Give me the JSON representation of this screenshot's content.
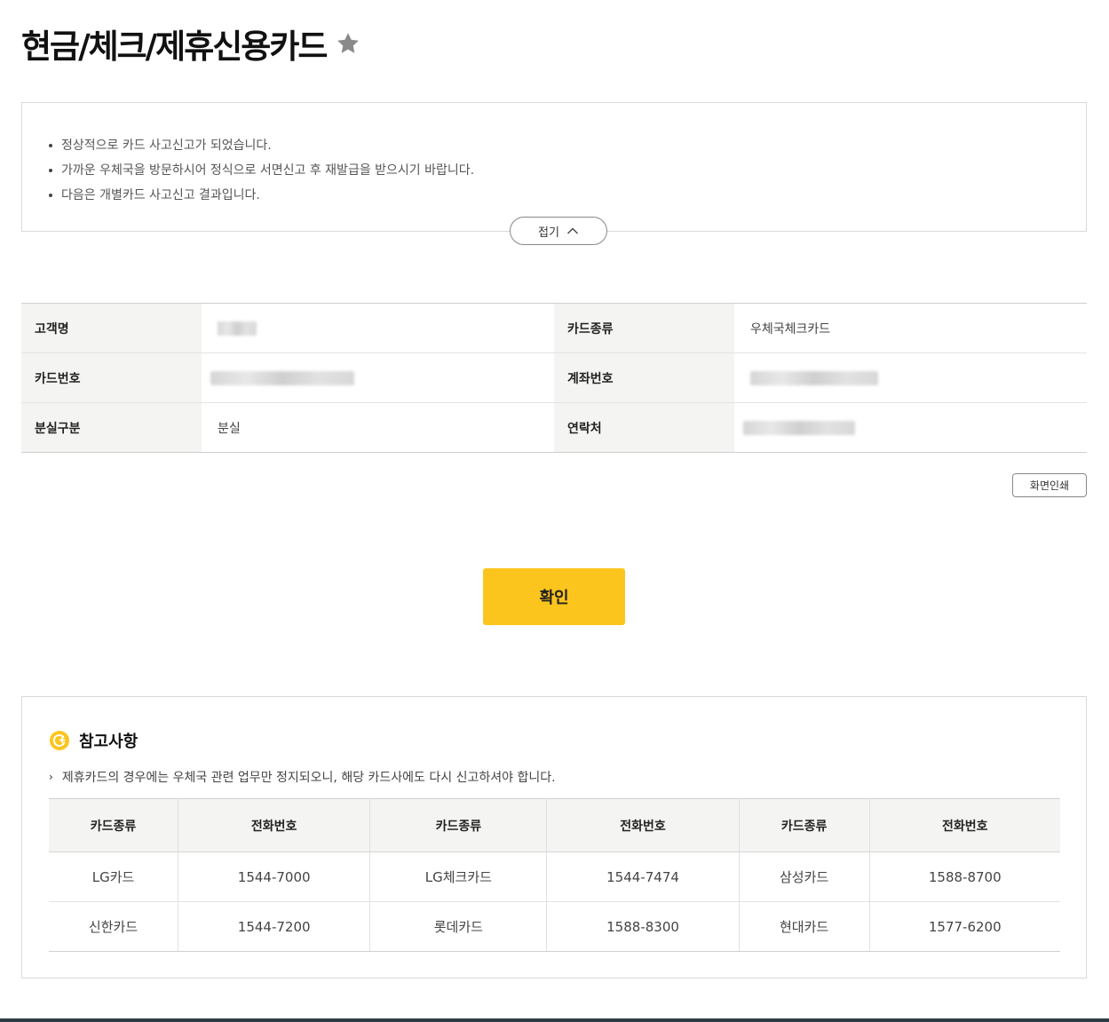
{
  "page": {
    "title": "현금/체크/제휴신용카드"
  },
  "notice": {
    "items": [
      "정상적으로 카드 사고신고가 되었습니다.",
      "가까운 우체국을 방문하시어 정식으로 서면신고 후 재발급을 받으시기 바랍니다.",
      "다음은 개별카드 사고신고 결과입니다."
    ],
    "fold_label": "접기"
  },
  "info": {
    "customer_name_label": "고객명",
    "customer_name_value": "",
    "card_type_label": "카드종류",
    "card_type_value": "우체국체크카드",
    "card_number_label": "카드번호",
    "card_number_value": "",
    "account_number_label": "계좌번호",
    "account_number_value": "",
    "loss_type_label": "분실구분",
    "loss_type_value": "분실",
    "contact_label": "연락처",
    "contact_value": ""
  },
  "actions": {
    "print_label": "화면인쇄",
    "confirm_label": "확인"
  },
  "reference": {
    "title": "참고사항",
    "note": "제휴카드의 경우에는 우체국 관련 업무만 정지되오니, 해당 카드사에도 다시 신고하셔야 합니다.",
    "headers": [
      "카드종류",
      "전화번호",
      "카드종류",
      "전화번호",
      "카드종류",
      "전화번호"
    ],
    "rows": [
      [
        "LG카드",
        "1544-7000",
        "LG체크카드",
        "1544-7474",
        "삼성카드",
        "1588-8700"
      ],
      [
        "신한카드",
        "1544-7200",
        "롯데카드",
        "1588-8300",
        "현대카드",
        "1577-6200"
      ]
    ]
  },
  "colors": {
    "accent": "#fcc51d",
    "header_bg": "#f4f4f2",
    "footer_bar": "#2d3b45"
  },
  "icons": {
    "favorite": "star-icon",
    "fold": "chevron-up-icon",
    "reference": "info-circle-icon"
  }
}
